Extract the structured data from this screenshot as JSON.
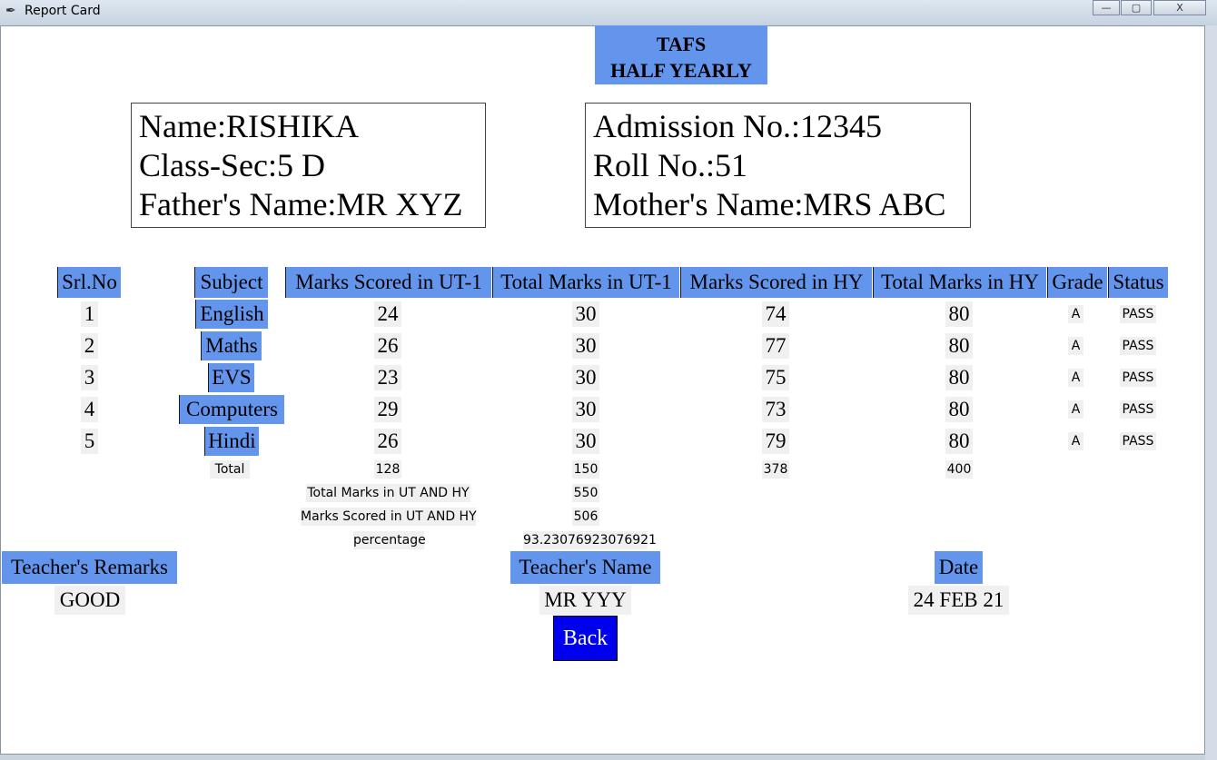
{
  "window": {
    "title": "Report Card",
    "buttons": {
      "minimize": "—",
      "maximize": "▢",
      "close": "X"
    }
  },
  "exam": {
    "school": "TAFS",
    "term": "HALF YEARLY"
  },
  "student": {
    "left": [
      "Name:RISHIKA",
      "Class-Sec:5 D",
      "Father's Name:MR XYZ"
    ],
    "right": [
      "Admission No.:12345",
      "Roll No.:51",
      "Mother's Name:MRS ABC"
    ]
  },
  "table": {
    "headers": [
      "Srl.No",
      "Subject",
      "Marks Scored in UT-1",
      "Total Marks in UT-1",
      "Marks Scored in HY",
      "Total Marks in HY",
      "Grade",
      "Status"
    ],
    "rows": [
      [
        "1",
        "English",
        "24",
        "30",
        "74",
        "80",
        "A",
        "PASS"
      ],
      [
        "2",
        "Maths",
        "26",
        "30",
        "77",
        "80",
        "A",
        "PASS"
      ],
      [
        "3",
        "EVS",
        "23",
        "30",
        "75",
        "80",
        "A",
        "PASS"
      ],
      [
        "4",
        "Computers",
        "29",
        "30",
        "73",
        "80",
        "A",
        "PASS"
      ],
      [
        "5",
        "Hindi",
        "26",
        "30",
        "79",
        "80",
        "A",
        "PASS"
      ]
    ],
    "totals": {
      "label": "Total",
      "ut_scored": "128",
      "ut_total": "150",
      "hy_scored": "378",
      "hy_total": "400"
    }
  },
  "summary": {
    "total_label": "Total Marks in UT AND HY",
    "total_value": "550",
    "scored_label": "Marks Scored in UT AND HY",
    "scored_value": "506",
    "percentage_label": "percentage",
    "percentage_value": "93.23076923076921"
  },
  "footer": {
    "remarks_label": "Teacher's Remarks",
    "remarks_value": "GOOD",
    "teacher_label": "Teacher's Name",
    "teacher_value": "MR YYY",
    "date_label": "Date",
    "date_value": "24 FEB 21"
  },
  "back_label": "Back",
  "colors": {
    "header_bg": "#6495ed",
    "cell_bg": "#f0f0f0",
    "back_bg": "#0000ee"
  }
}
